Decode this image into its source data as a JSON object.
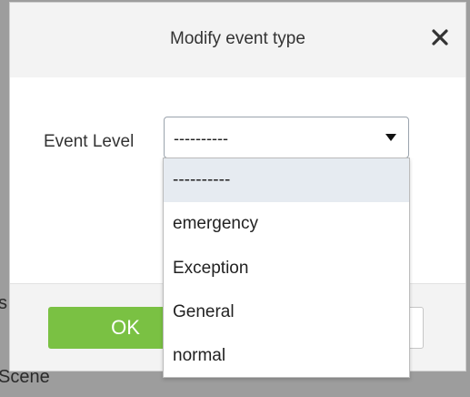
{
  "background": {
    "partial_text_s": "s",
    "partial_text_scene": "Scene"
  },
  "dialog": {
    "title": "Modify event type",
    "close_icon": "close-icon"
  },
  "form": {
    "event_level_label": "Event Level",
    "event_level_value": "----------",
    "caret_icon": "caret-down-icon"
  },
  "dropdown": {
    "options": [
      {
        "label": "----------",
        "selected": true
      },
      {
        "label": "emergency",
        "selected": false
      },
      {
        "label": "Exception",
        "selected": false
      },
      {
        "label": "General",
        "selected": false
      },
      {
        "label": "normal",
        "selected": false
      }
    ]
  },
  "footer": {
    "ok_label": "OK",
    "cancel_label": ""
  },
  "colors": {
    "ok_green": "#7ac143",
    "selected_option_bg": "#e6ebf1",
    "overlay_bg": "#9d9d9d"
  }
}
